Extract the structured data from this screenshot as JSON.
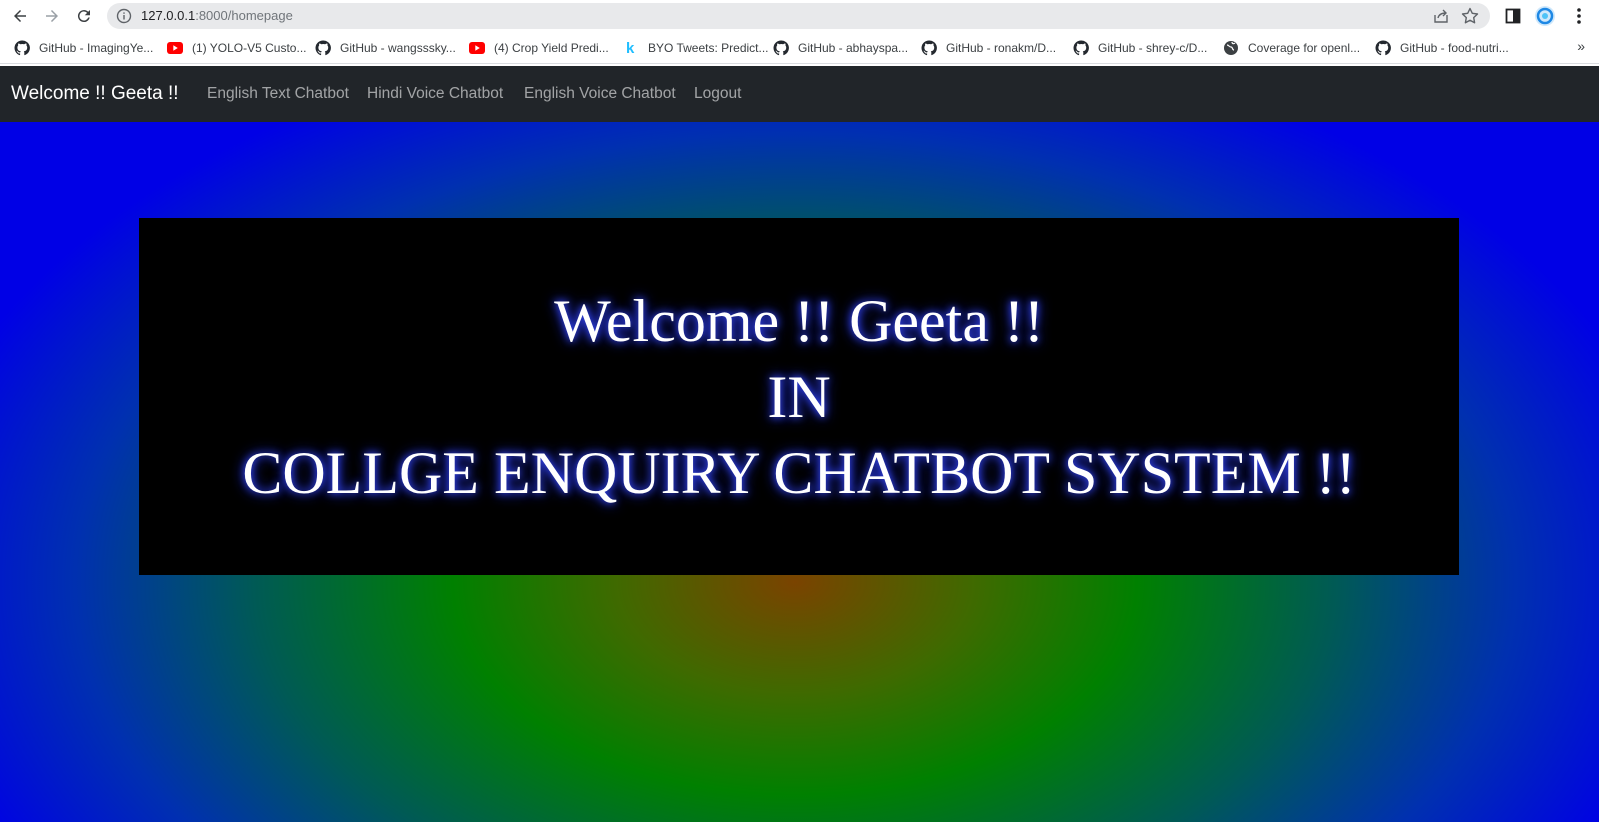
{
  "browser": {
    "url_host": "127.0.0.1",
    "url_rest": ":8000/homepage"
  },
  "bookmarks": [
    {
      "label": "GitHub - ImagingYe...",
      "icon": "github-icon"
    },
    {
      "label": "(1) YOLO-V5 Custo...",
      "icon": "youtube-icon"
    },
    {
      "label": "GitHub - wangsssky...",
      "icon": "github-icon"
    },
    {
      "label": "(4) Crop Yield Predi...",
      "icon": "youtube-icon"
    },
    {
      "label": "BYO Tweets: Predict...",
      "icon": "k-icon"
    },
    {
      "label": "GitHub - abhayspa...",
      "icon": "github-icon"
    },
    {
      "label": "GitHub - ronakm/D...",
      "icon": "github-icon"
    },
    {
      "label": "GitHub - shrey-c/D...",
      "icon": "github-icon"
    },
    {
      "label": "Coverage for openl...",
      "icon": "globe-icon"
    },
    {
      "label": "GitHub - food-nutri...",
      "icon": "github-icon"
    }
  ],
  "bookmarks_more": "»",
  "navbar": {
    "brand": "Welcome !! Geeta !!",
    "links": [
      "English Text Chatbot",
      "Hindi Voice Chatbot",
      "English Voice Chatbot",
      "Logout"
    ]
  },
  "hero": {
    "line1": "Welcome !! Geeta !!",
    "line2": "IN",
    "line3": "COLLGE ENQUIRY CHATBOT SYSTEM !!"
  },
  "colors": {
    "navbar_bg": "#212529",
    "box_bg": "#000000",
    "glow": "#2233ff"
  }
}
